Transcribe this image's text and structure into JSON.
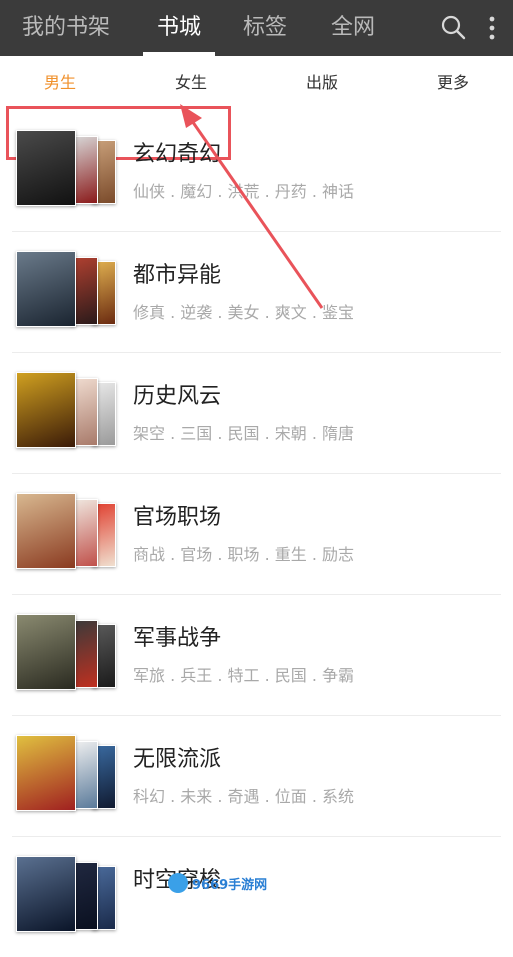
{
  "nav": {
    "tabs": [
      {
        "label": "我的书架"
      },
      {
        "label": "书城"
      },
      {
        "label": "标签"
      },
      {
        "label": "全网"
      }
    ],
    "icons": [
      "search-icon",
      "more-vert-icon"
    ]
  },
  "subtabs": [
    {
      "label": "男生"
    },
    {
      "label": "女生"
    },
    {
      "label": "出版"
    },
    {
      "label": "更多"
    }
  ],
  "colors": {
    "accent": "#f0912c",
    "topbar": "#3b3b3b",
    "annotation": "#e9535a"
  },
  "categories": [
    {
      "title": "玄幻奇幻",
      "tags": "仙侠 . 魔幻 . 洪荒 . 丹药 . 神话"
    },
    {
      "title": "都市异能",
      "tags": "修真 . 逆袭 . 美女 . 爽文 . 鉴宝"
    },
    {
      "title": "历史风云",
      "tags": "架空 . 三国 . 民国 . 宋朝 . 隋唐"
    },
    {
      "title": "官场职场",
      "tags": "商战 . 官场 . 职场 . 重生 . 励志"
    },
    {
      "title": "军事战争",
      "tags": "军旅 . 兵王 . 特工 . 民国 . 争霸"
    },
    {
      "title": "无限流派",
      "tags": "科幻 . 未来 . 奇遇 . 位面 . 系统"
    },
    {
      "title": "时空穿梭",
      "tags": ""
    }
  ],
  "watermark": {
    "text": "9669手游网"
  }
}
